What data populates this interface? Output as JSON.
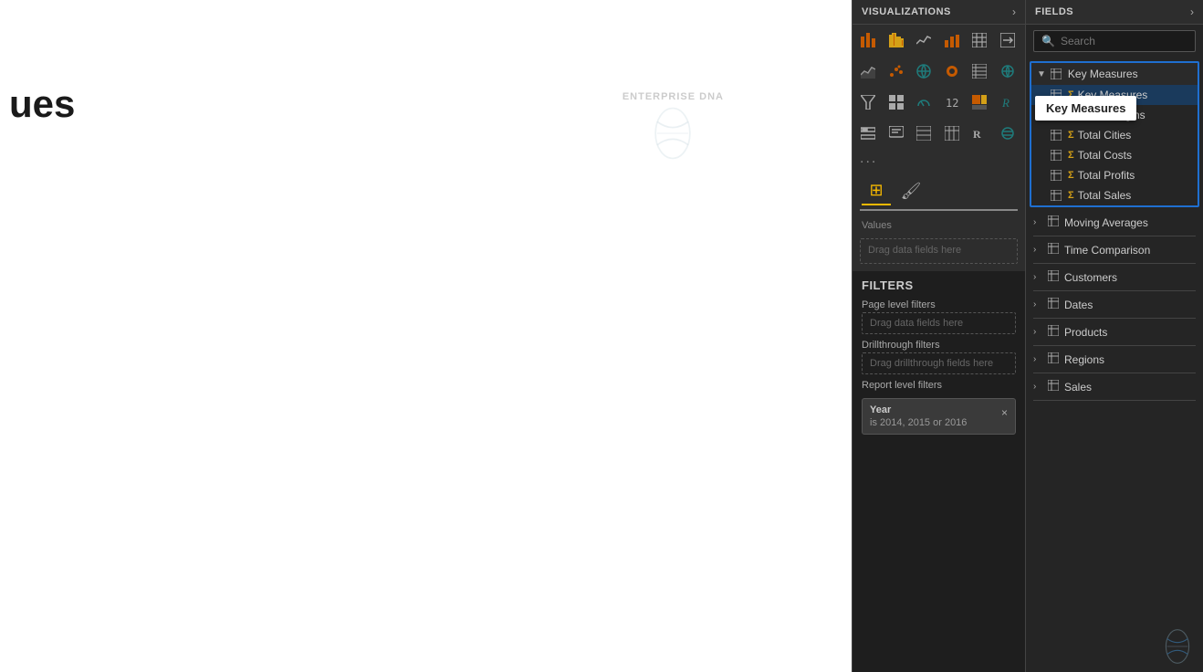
{
  "canvas": {
    "title": "ues"
  },
  "visualizations": {
    "header_title": "VISUALIZATIONS",
    "dots": "...",
    "values_label": "Values",
    "drag_zone": "Drag data fields here"
  },
  "filters": {
    "title": "FILTERS",
    "page_level": "Page level filters",
    "drag_here": "Drag data fields here",
    "drillthrough": "Drillthrough filters",
    "drag_drillthrough": "Drag drillthrough fields here",
    "report_level": "Report level filters",
    "filter_tag": {
      "title": "Year",
      "value": "is 2014, 2015 or 2016",
      "close": "×"
    }
  },
  "fields": {
    "header_title": "FIELDS",
    "search_placeholder": "Search",
    "tooltip_label": "Key Measures",
    "key_measures": {
      "label": "Key Measures",
      "items": [
        {
          "name": "Key Measures",
          "type": "measure"
        },
        {
          "name": "Profit Margins",
          "type": "measure"
        },
        {
          "name": "Total Cities",
          "type": "measure"
        },
        {
          "name": "Total Costs",
          "type": "measure"
        },
        {
          "name": "Total Profits",
          "type": "measure"
        },
        {
          "name": "Total Sales",
          "type": "measure"
        }
      ]
    },
    "groups": [
      {
        "name": "Moving Averages",
        "type": "table"
      },
      {
        "name": "Time Comparison",
        "type": "table"
      },
      {
        "name": "Customers",
        "type": "table"
      },
      {
        "name": "Dates",
        "type": "table"
      },
      {
        "name": "Products",
        "type": "table"
      },
      {
        "name": "Regions",
        "type": "table"
      },
      {
        "name": "Sales",
        "type": "table"
      }
    ]
  }
}
